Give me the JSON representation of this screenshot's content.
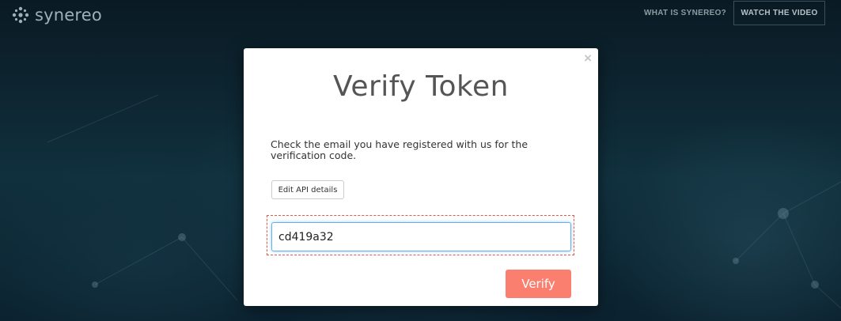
{
  "header": {
    "logo_text": "synereo",
    "nav_link": "WHAT IS SYNEREO?",
    "nav_button": "WATCH THE VIDEO"
  },
  "modal": {
    "close_label": "×",
    "title": "Verify Token",
    "description": "Check the email you have registered with us for the verification code.",
    "edit_button_label": "Edit API details",
    "token_value": "cd419a32",
    "verify_button_label": "Verify"
  },
  "colors": {
    "accent": "#fa7f6f",
    "input_focus": "#66afe9",
    "highlight": "#e05a4a"
  }
}
